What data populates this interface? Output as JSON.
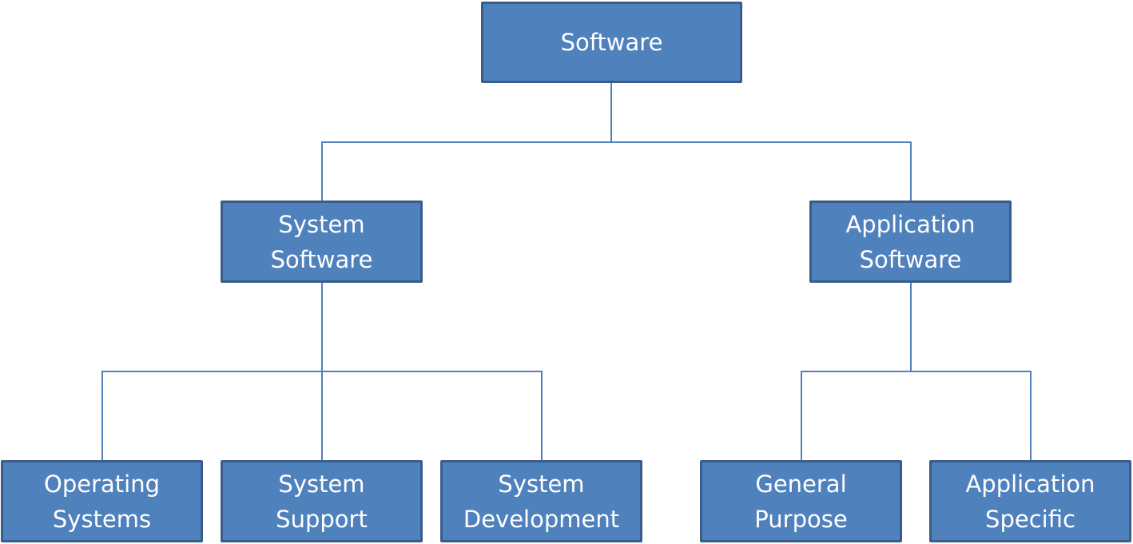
{
  "colors": {
    "fill": "#4F81BD",
    "border": "#385D8A",
    "connector": "#4F81BD",
    "text": "#FFFFFF"
  },
  "nodes": {
    "root": "Software",
    "system": "System\nSoftware",
    "application": "Application\nSoftware",
    "os": "Operating\nSystems",
    "support": "System\nSupport",
    "development": "System\nDevelopment",
    "general": "General\nPurpose",
    "specific": "Application\nSpecific"
  }
}
